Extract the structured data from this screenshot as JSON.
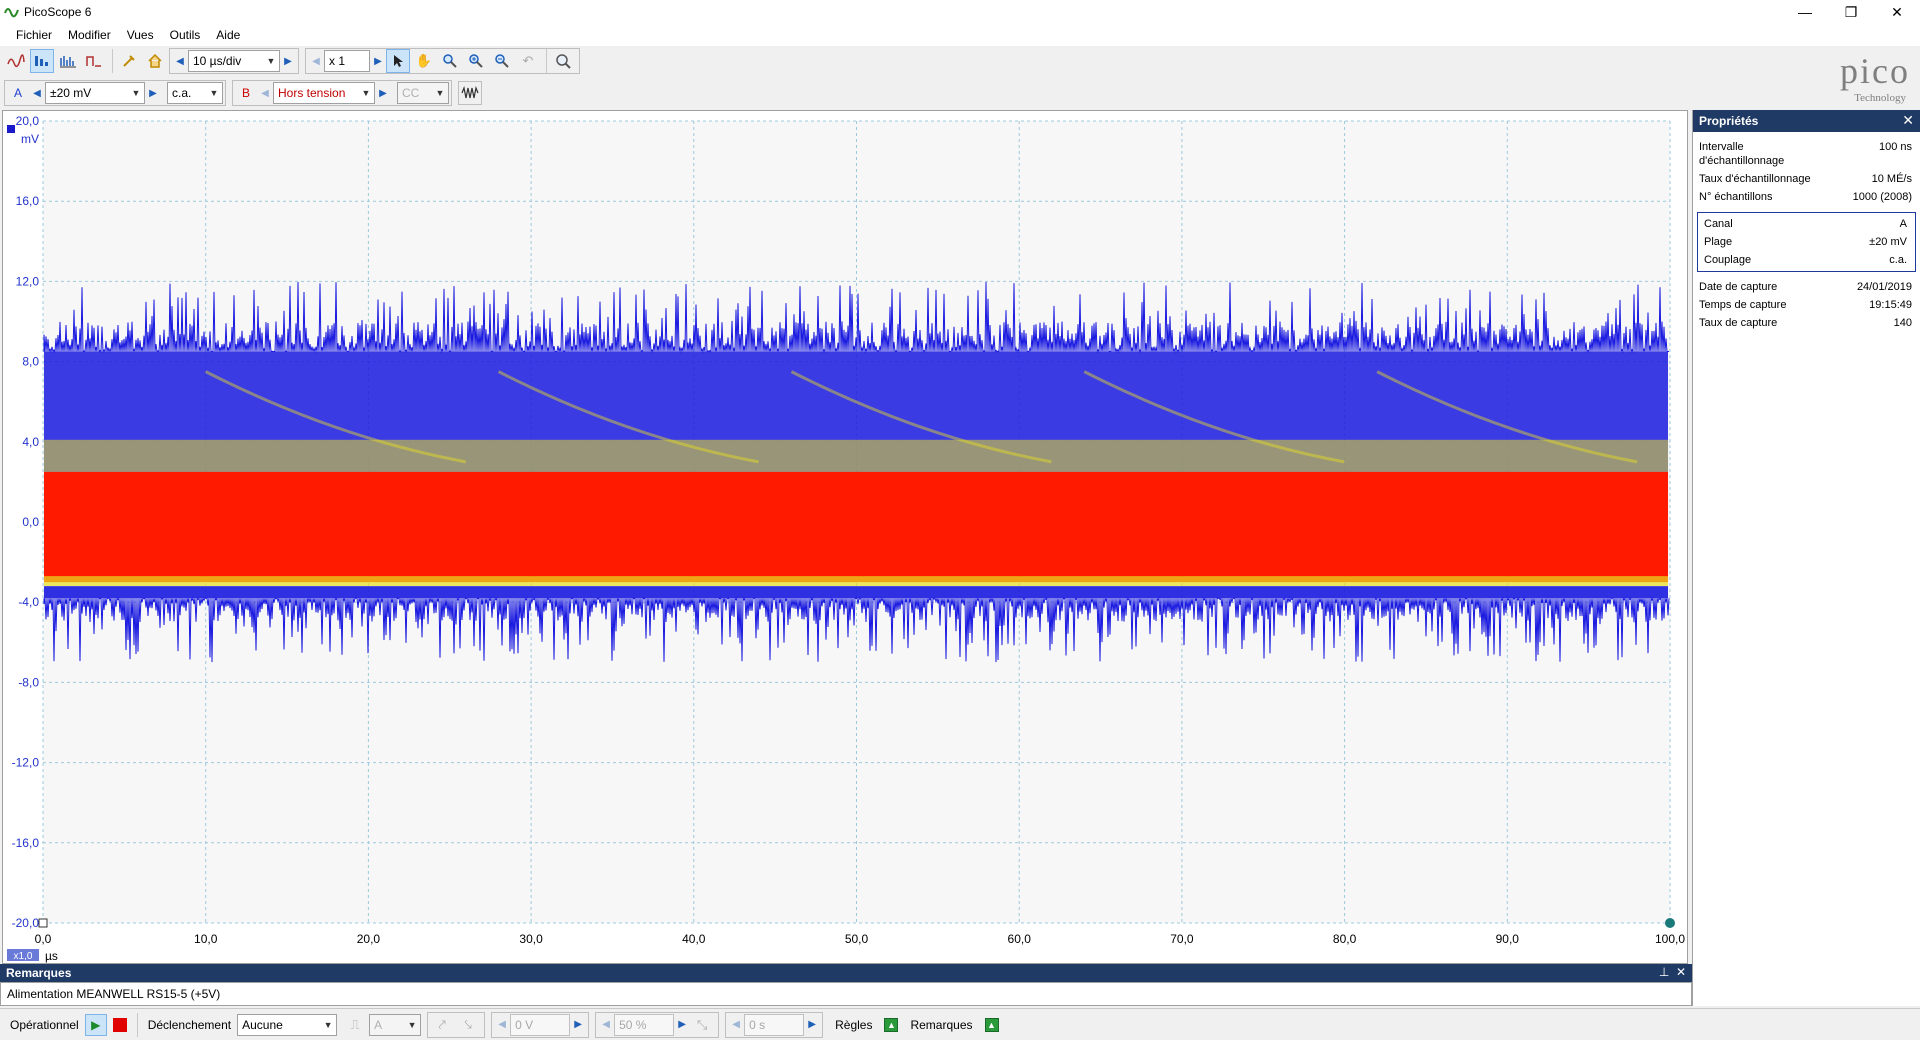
{
  "window": {
    "title": "PicoScope 6",
    "minimize": "—",
    "maximize": "❐",
    "close": "✕"
  },
  "menu": [
    "Fichier",
    "Modifier",
    "Vues",
    "Outils",
    "Aide"
  ],
  "toolbar1": {
    "timebase": "10 µs/div",
    "zoom": "x 1"
  },
  "toolbar2": {
    "channel_a": {
      "label": "A",
      "range": "±20 mV",
      "coupling": "c.a."
    },
    "channel_b": {
      "label": "B",
      "range": "Hors tension",
      "coupling": "CC"
    }
  },
  "logo": {
    "brand": "pico",
    "sub": "Technology"
  },
  "scope": {
    "y_unit": "mV",
    "x_unit": "µs",
    "x_scale_badge": "x1,0",
    "colors": {
      "background": "#f7f7f7",
      "grid": "#9ec9dc",
      "trace_blue": "#1a1ae0",
      "persistence_yellow": "#e8e020",
      "persistence_red": "#ff1a00",
      "axis_text": "#2233cc"
    }
  },
  "chart_data": {
    "type": "line",
    "title": "",
    "xlabel": "µs",
    "ylabel": "mV",
    "xlim": [
      0,
      100
    ],
    "ylim": [
      -20,
      20
    ],
    "x_ticks": [
      "0,0",
      "10,0",
      "20,0",
      "30,0",
      "40,0",
      "50,0",
      "60,0",
      "70,0",
      "80,0",
      "90,0",
      "100,0"
    ],
    "y_ticks": [
      "20,0",
      "16,0",
      "12,0",
      "8,0",
      "4,0",
      "0,0",
      "-4,0",
      "-8,0",
      "-12,0",
      "-16,0",
      "-20,0"
    ],
    "grid": true,
    "series": [
      {
        "name": "A",
        "envelope_max": 12.0,
        "envelope_min": -7.0,
        "dense_band": [
          -3.0,
          2.5
        ],
        "mid_band_top": 8.5
      }
    ]
  },
  "properties": {
    "header": "Propriétés",
    "rows": [
      {
        "k": "Intervalle d'échantillonnage",
        "v": "100 ns"
      },
      {
        "k": "Taux d'échantillonnage",
        "v": "10 MÉ/s"
      },
      {
        "k": "N° échantillons",
        "v": "1000  (2008)"
      }
    ],
    "channel_rows": [
      {
        "k": "Canal",
        "v": "A"
      },
      {
        "k": "Plage",
        "v": "±20 mV"
      },
      {
        "k": "Couplage",
        "v": "c.a."
      }
    ],
    "capture_rows": [
      {
        "k": "Date de capture",
        "v": "24/01/2019"
      },
      {
        "k": "Temps de capture",
        "v": "19:15:49"
      },
      {
        "k": "Taux de capture",
        "v": "140"
      }
    ]
  },
  "remarks": {
    "header": "Remarques",
    "text": "Alimentation MEANWELL RS15-5 (+5V)"
  },
  "status": {
    "mode": "Opérationnel",
    "trigger_label": "Déclenchement",
    "trigger_mode": "Aucune",
    "trigger_channel": "A",
    "trigger_level": "0 V",
    "pre_trigger": "50 %",
    "delay": "0 s",
    "rules": "Règles",
    "notes": "Remarques"
  }
}
